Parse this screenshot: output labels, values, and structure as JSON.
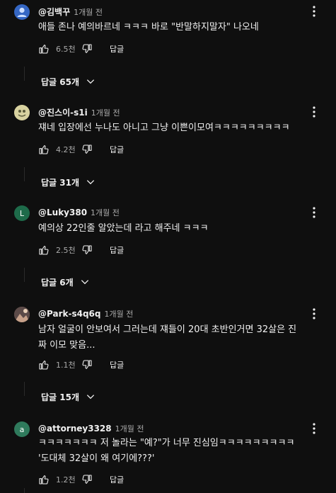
{
  "comments": [
    {
      "author": "@김백꾸",
      "time": "1개월 전",
      "avatar_letter": "",
      "avatar_color": "#3567c4",
      "lines": [
        "애들 존나 예의바르네 ㅋㅋㅋ 바로 \"반말하지말자\" 나오네"
      ],
      "likes": "6.5천",
      "reply_label": "답글",
      "replies_label": "답글 65개"
    },
    {
      "author": "@진스이-s1i",
      "time": "1개월 전",
      "avatar_letter": "",
      "avatar_color": "#c9c08a",
      "lines": [
        "쟤네 입장에선 누나도 아니고 그냥 이쁜이모여ㅋㅋㅋㅋㅋㅋㅋㅋㅋ"
      ],
      "likes": "4.2천",
      "reply_label": "답글",
      "replies_label": "답글 31개"
    },
    {
      "author": "@Luky380",
      "time": "1개월 전",
      "avatar_letter": "L",
      "avatar_color": "#1e6b4a",
      "lines": [
        "예의상 22인줄 알았는데 라고 해주네 ㅋㅋㅋ"
      ],
      "likes": "2.5천",
      "reply_label": "답글",
      "replies_label": "답글 6개"
    },
    {
      "author": "@Park-s4q6q",
      "time": "1개월 전",
      "avatar_letter": "",
      "avatar_color": "#8a6a5a",
      "lines": [
        "남자 얼굴이 안보여서 그러는데 쟤들이 20대 초반인거면 32살은 진",
        "짜 이모 맞음..."
      ],
      "likes": "1.1천",
      "reply_label": "답글",
      "replies_label": "답글 15개"
    },
    {
      "author": "@attorney3328",
      "time": "1개월 전",
      "avatar_letter": "a",
      "avatar_color": "#2f7a5c",
      "lines": [
        "ㅋㅋㅋㅋㅋㅋㅋ 저 놀라는 \"예?\"가 너무 진심임ㅋㅋㅋㅋㅋㅋㅋㅋㅋ",
        "'도대체 32살이 왜 여기에???'"
      ],
      "likes": "1.2천",
      "reply_label": "답글",
      "replies_label": ""
    }
  ],
  "icons": {
    "like": "thumb-up-icon",
    "dislike": "thumb-down-icon",
    "more": "more-vert-icon",
    "expand": "chevron-down-icon"
  }
}
